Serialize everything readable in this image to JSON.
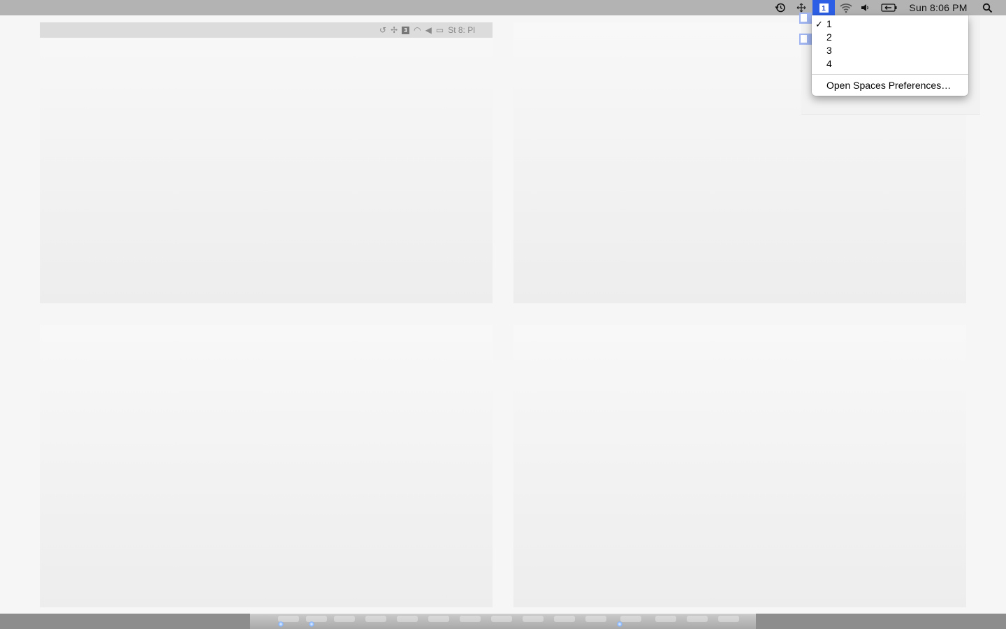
{
  "menubar": {
    "clock": "Sun 8:06 PM",
    "icons": [
      "time-machine-icon",
      "spaces-move-icon",
      "spaces-number-icon",
      "wifi-icon",
      "volume-icon",
      "battery-icon",
      "spotlight-icon"
    ],
    "active_space": "1",
    "accent": "#2c5fe6"
  },
  "spaces_menu": {
    "items": [
      {
        "label": "1",
        "checked": true
      },
      {
        "label": "2",
        "checked": false
      },
      {
        "label": "3",
        "checked": false
      },
      {
        "label": "4",
        "checked": false
      }
    ],
    "check_mark": "✓",
    "preferences": "Open Spaces Preferences…"
  },
  "space_thumbnail": {
    "clock_fragment": "St 8: Pl",
    "space_number": "3"
  }
}
